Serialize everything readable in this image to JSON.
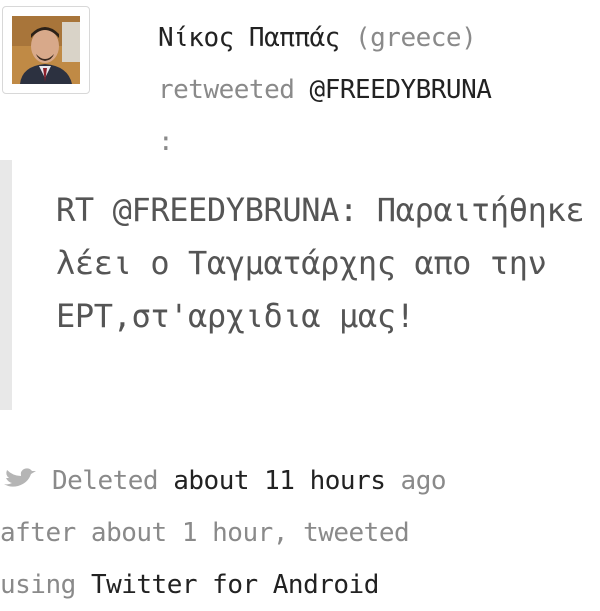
{
  "user": {
    "name": "Νίκος Παππάς",
    "location": "(greece)",
    "action": "retweeted",
    "original_handle": "@FREEDYBRUNA",
    "colon": ":"
  },
  "tweet": {
    "text": "RT @FREEDYBRUNA: Παραιτήθηκε λέει ο Ταγματάρχης απο την ΕΡΤ,στ'αρχιδια μας!"
  },
  "meta": {
    "deleted_label": "Deleted",
    "deleted_time": "about 11 hours",
    "ago": "ago",
    "after_label": "after about 1 hour, tweeted",
    "using_label": "using",
    "client": "Twitter for Android"
  },
  "icons": {
    "avatar": "user-avatar",
    "bird": "twitter-bird-icon"
  },
  "colors": {
    "gray_text": "#8a8a8a",
    "dark_text": "#222222",
    "quote_bar": "#e8e8e8"
  }
}
